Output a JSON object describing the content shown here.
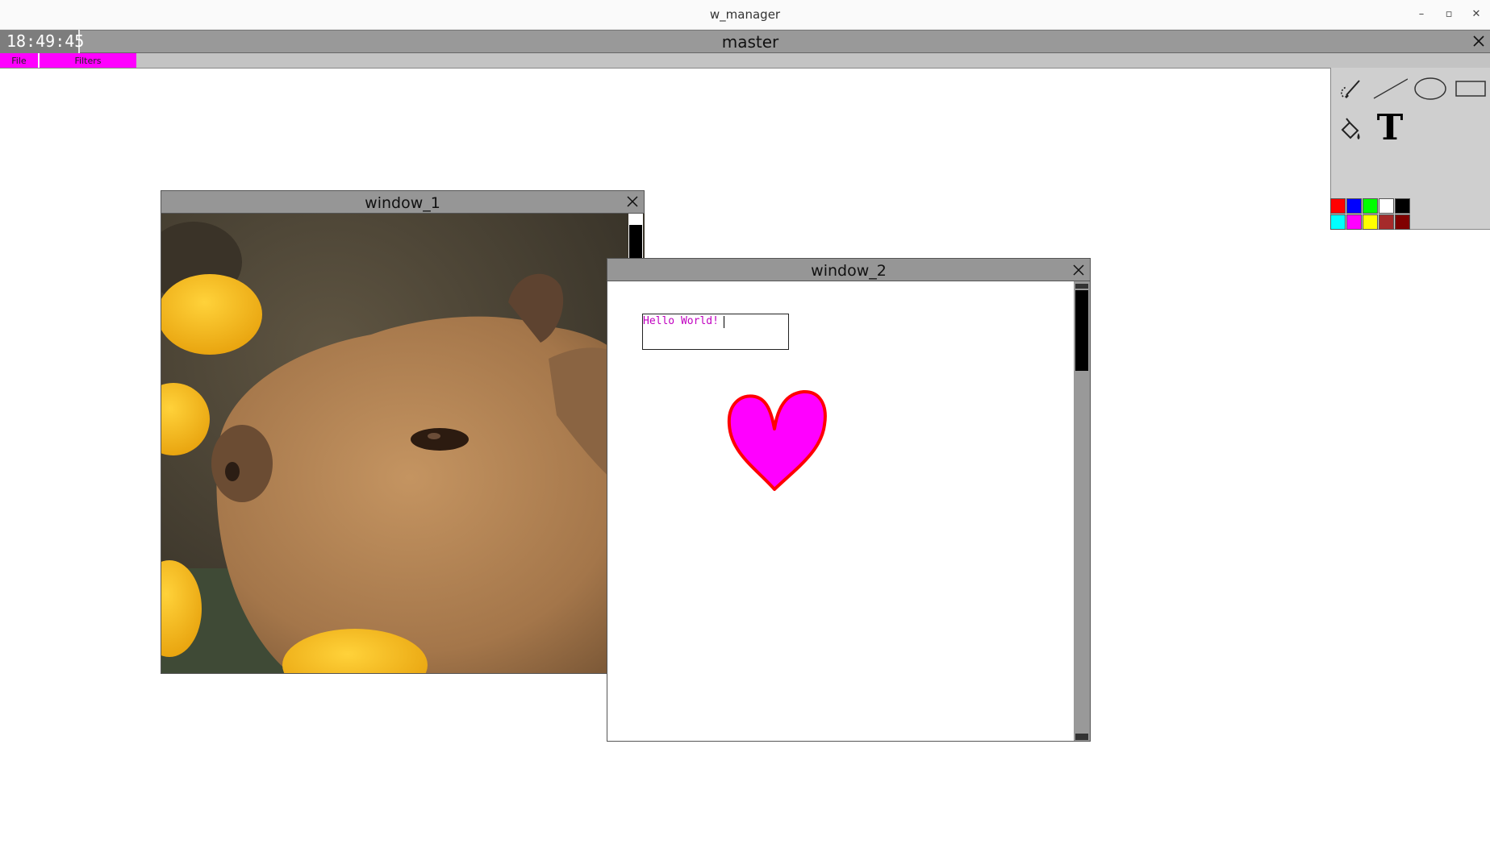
{
  "os_window": {
    "title": "w_manager",
    "controls": {
      "minimize": "–",
      "maximize": "▫",
      "close": "✕"
    }
  },
  "master": {
    "clock": "18:49:45",
    "title": "master"
  },
  "menu": {
    "items": [
      {
        "label": "File"
      },
      {
        "label": "Filters"
      }
    ],
    "accent_color": "#ff00ff"
  },
  "palette": {
    "tools": [
      "freehand-brush-icon",
      "line-icon",
      "ellipse-icon",
      "rectangle-icon",
      "paint-bucket-icon",
      "text-tool-icon"
    ],
    "text_tool_glyph": "T",
    "colors_row1": [
      "#ff0000",
      "#0000ff",
      "#00ff00",
      "#ffffff",
      "#000000"
    ],
    "colors_row2": [
      "#00ffff",
      "#ff00ff",
      "#ffff00",
      "#a52a2a",
      "#800000"
    ]
  },
  "window_1": {
    "title": "window_1",
    "content": "capybara photo"
  },
  "window_2": {
    "title": "window_2",
    "textbox_value": "Hello World!",
    "text_color": "#c000c0",
    "heart_fill": "#ff00ff",
    "heart_stroke": "#ff0000"
  }
}
